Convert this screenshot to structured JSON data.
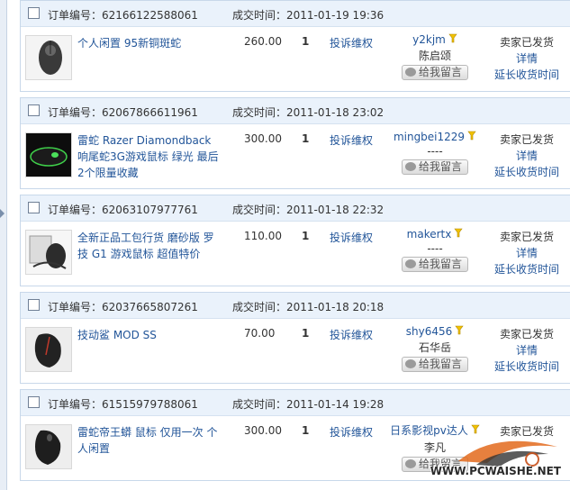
{
  "labels": {
    "order_no_prefix": "订单编号：",
    "time_prefix": "成交时间：",
    "complaint": "投诉维权",
    "leave_msg": "给我留言",
    "status": "卖家已发货",
    "detail": "详情",
    "extend": "延长收货时间"
  },
  "orders": [
    {
      "order_no": "订单编号：62166122588061",
      "deal_time": "成交时间：2011-01-19 19:36",
      "title": "个人闲置 95新铜斑蛇",
      "price": "260.00",
      "qty": "1",
      "buyer_id": "y2kjm",
      "buyer_name": "陈启颂"
    },
    {
      "order_no": "订单编号：62067866611961",
      "deal_time": "成交时间：2011-01-18 23:02",
      "title": "雷蛇 Razer Diamondback 响尾蛇3G游戏鼠标 绿光 最后2个限量收藏",
      "price": "300.00",
      "qty": "1",
      "buyer_id": "mingbei1229",
      "buyer_name": "----"
    },
    {
      "order_no": "订单编号：62063107977761",
      "deal_time": "成交时间：2011-01-18 22:32",
      "title": "全新正品工包行货 磨砂版 罗技 G1 游戏鼠标 超值特价",
      "price": "110.00",
      "qty": "1",
      "buyer_id": "makertx",
      "buyer_name": "----"
    },
    {
      "order_no": "订单编号：62037665807261",
      "deal_time": "成交时间：2011-01-18 20:18",
      "title": "技动鲨 MOD SS",
      "price": "70.00",
      "qty": "1",
      "buyer_id": "shy6456",
      "buyer_name": "石华岳"
    },
    {
      "order_no": "订单编号：61515979788061",
      "deal_time": "成交时间：2011-01-14 19:28",
      "title": "雷蛇帝王蟒 鼠标 仅用一次 个人闲置",
      "price": "300.00",
      "qty": "1",
      "buyer_id": "日系影视pv达人",
      "buyer_name": "李凡"
    }
  ],
  "watermark": {
    "text": "WWW.PCWAISHE.NET"
  },
  "colors": {
    "link": "#225599",
    "header_bg": "#eaf2fb",
    "border": "#c8d8ea",
    "flag": "#f2c200"
  }
}
